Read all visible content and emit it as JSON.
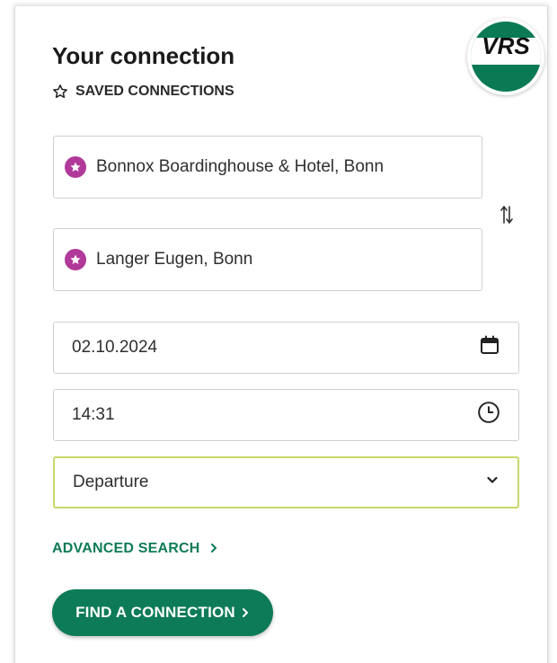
{
  "brand": {
    "logo_text": "VRS",
    "accent": "#0e7b58",
    "favorite_color": "#b0399a",
    "select_border": "#c7d86d"
  },
  "header": {
    "title": "Your connection",
    "saved_label": "SAVED CONNECTIONS"
  },
  "form": {
    "origin": {
      "value": "Bonnox Boardinghouse & Hotel, Bonn",
      "icon": "favorite-star-icon"
    },
    "destination": {
      "value": "Langer Eugen, Bonn",
      "icon": "favorite-star-icon"
    },
    "swap_icon": "swap-arrows-icon",
    "date": {
      "value": "02.10.2024",
      "icon": "calendar-icon"
    },
    "time": {
      "value": "14:31",
      "icon": "clock-icon"
    },
    "mode": {
      "value": "Departure",
      "icon": "chevron-down-icon"
    }
  },
  "actions": {
    "advanced_search": "ADVANCED SEARCH",
    "find_connection": "FIND A CONNECTION"
  }
}
